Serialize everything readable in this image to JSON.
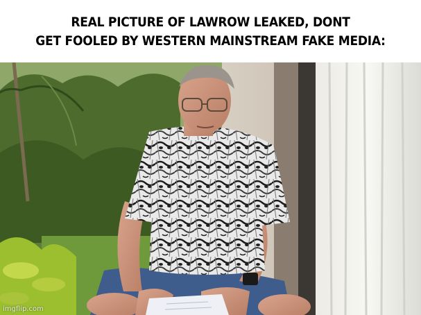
{
  "meme": {
    "caption_line1": "REAL PICTURE OF LAWROW LEAKED, DONT",
    "caption_line2": "GET FOOLED BY WESTERN MAINSTREAM FAKE MEDIA:",
    "watermark": "imgflip.com"
  }
}
